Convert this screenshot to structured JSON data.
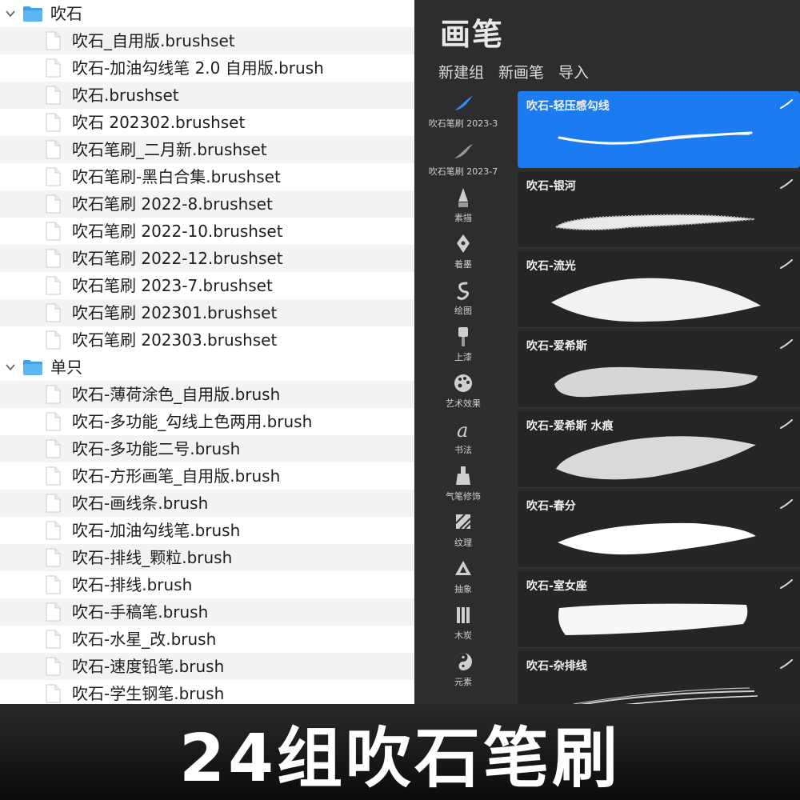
{
  "file_list": {
    "folders": [
      {
        "name": "吹石",
        "files": [
          "吹石_自用版.brushset",
          "吹石-加油勾线笔 2.0 自用版.brush",
          "吹石.brushset",
          "吹石 202302.brushset",
          "吹石笔刷_二月新.brushset",
          "吹石笔刷-黑白合集.brushset",
          "吹石笔刷 2022-8.brushset",
          "吹石笔刷 2022-10.brushset",
          "吹石笔刷 2022-12.brushset",
          "吹石笔刷 2023-7.brushset",
          "吹石笔刷 202301.brushset",
          "吹石笔刷 202303.brushset"
        ]
      },
      {
        "name": "单只",
        "files": [
          "吹石-薄荷涂色_自用版.brush",
          "吹石-多功能_勾线上色两用.brush",
          "吹石-多功能二号.brush",
          "吹石-方形画笔_自用版.brush",
          "吹石-画线条.brush",
          "吹石-加油勾线笔.brush",
          "吹石-排线_颗粒.brush",
          "吹石-排线.brush",
          "吹石-手稿笔.brush",
          "吹石-水星_改.brush",
          "吹石-速度铅笔.brush",
          "吹石-学生钢笔.brush"
        ]
      }
    ]
  },
  "brush_library": {
    "title": "画笔",
    "actions": [
      "新建组",
      "新画笔",
      "导入"
    ],
    "categories": [
      {
        "label": "吹石笔刷 2023-3",
        "icon": "brush-stroke-blue-icon"
      },
      {
        "label": "吹石笔刷 2023-7",
        "icon": "brush-stroke-icon"
      },
      {
        "label": "素描",
        "icon": "pencil-icon"
      },
      {
        "label": "着墨",
        "icon": "pen-nib-icon"
      },
      {
        "label": "绘图",
        "icon": "squiggle-icon"
      },
      {
        "label": "上漆",
        "icon": "paint-brush-icon"
      },
      {
        "label": "艺术效果",
        "icon": "palette-icon"
      },
      {
        "label": "书法",
        "icon": "calligraphy-icon"
      },
      {
        "label": "气笔修饰",
        "icon": "airbrush-icon"
      },
      {
        "label": "纹理",
        "icon": "texture-icon"
      },
      {
        "label": "抽象",
        "icon": "triangle-icon"
      },
      {
        "label": "木炭",
        "icon": "charcoal-icon"
      },
      {
        "label": "元素",
        "icon": "yin-yang-icon"
      }
    ],
    "brushes": [
      {
        "name": "吹石-轻压感勾线",
        "selected": true
      },
      {
        "name": "吹石-银河",
        "selected": false
      },
      {
        "name": "吹石-流光",
        "selected": false
      },
      {
        "name": "吹石-爱希斯",
        "selected": false
      },
      {
        "name": "吹石-爱希斯 水痕",
        "selected": false
      },
      {
        "name": "吹石-春分",
        "selected": false
      },
      {
        "name": "吹石-室女座",
        "selected": false
      },
      {
        "name": "吹石-杂排线",
        "selected": false
      }
    ]
  },
  "banner": {
    "text": "24组吹石笔刷"
  },
  "colors": {
    "accent": "#1a7cf0",
    "folder": "#3aa0e8",
    "panel_dark": "#2d2d2e"
  }
}
